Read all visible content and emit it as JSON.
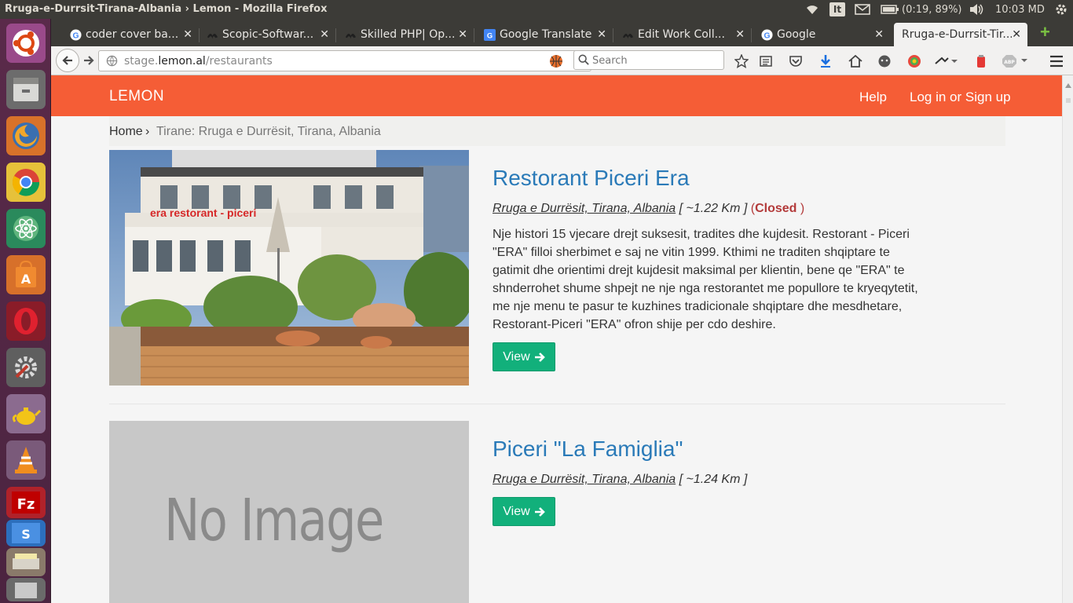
{
  "system": {
    "window_title": "Rruga-e-Durrsit-Tirana-Albania › Lemon - Mozilla Firefox",
    "input_indicator": "It",
    "battery_text": "(0:19, 89%)",
    "clock": "10:03 MD"
  },
  "browser": {
    "tabs": [
      {
        "label": "coder cover ba...",
        "icon": "google-icon"
      },
      {
        "label": "Scopic-Softwar...",
        "icon": "upwork-icon"
      },
      {
        "label": "Skilled PHP| Op...",
        "icon": "upwork-icon"
      },
      {
        "label": "Google Translate",
        "icon": "translate-icon"
      },
      {
        "label": "Edit Work Coll...",
        "icon": "upwork-icon"
      },
      {
        "label": "Google",
        "icon": "google-icon"
      },
      {
        "label": "Rruga-e-Durrsit-Tir...",
        "icon": "",
        "active": true
      }
    ],
    "url_prefix": "stage.",
    "url_domain": "lemon.al",
    "url_path": "/restaurants",
    "search_placeholder": "Search"
  },
  "site": {
    "brand": "LEMON",
    "nav": {
      "help": "Help",
      "login": "Log in or Sign up"
    },
    "breadcrumb": {
      "home": "Home",
      "separator": "›",
      "current": "Tirane: Rruga e Durrësit, Tirana, Albania"
    },
    "accent_color": "#f55d36",
    "link_color": "#2a7ab8",
    "button_color": "#12b07b"
  },
  "restaurants": [
    {
      "name": "Restorant Piceri Era",
      "address": "Rruga e Durrësit, Tirana, Albania",
      "distance": "[ ~1.22 Km ]",
      "status": "Closed",
      "description": "Nje histori 15 vjecare drejt suksesit, tradites dhe kujdesit. Restorant - Piceri \"ERA\" filloi sherbimet e saj ne vitin 1999. Kthimi ne traditen shqiptare te gatimit dhe orientimi drejt kujdesit maksimal per klientin, bene qe \"ERA\" te shnderrohet shume shpejt ne nje nga restorantet me popullore te kryeqytetit, me nje menu te pasur te kuzhines tradicionale shqiptare dhe mesdhetare, Restorant-Piceri \"ERA\" ofron shije per cdo deshire.",
      "view_label": "View",
      "image_sign": "era restorant - piceri"
    },
    {
      "name": "Piceri \"La Famiglia\"",
      "address": "Rruga e Durrësit, Tirana, Albania",
      "distance": "[ ~1.24 Km ]",
      "view_label": "View",
      "image_placeholder": "No Image"
    }
  ]
}
